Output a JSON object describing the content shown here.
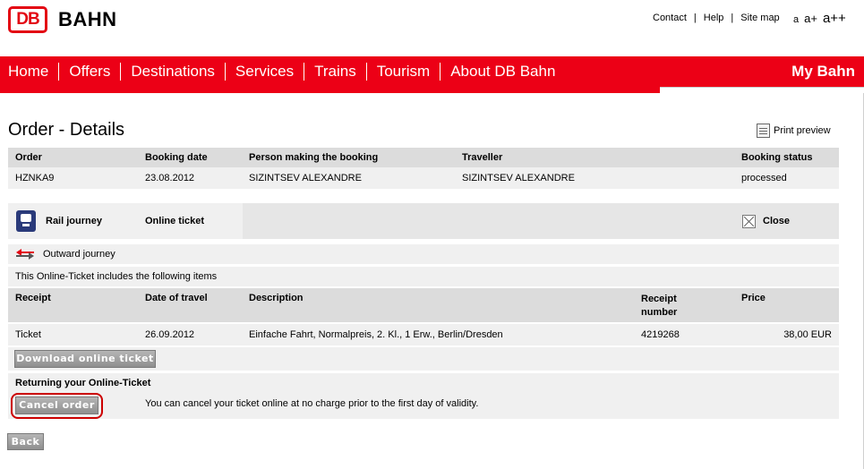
{
  "header": {
    "logo_db": "DB",
    "logo_text": "BAHN",
    "links": [
      "Contact",
      "Help",
      "Site map"
    ],
    "font_sizes": [
      "a",
      "a+",
      "a++"
    ]
  },
  "nav": {
    "items": [
      "Home",
      "Offers",
      "Destinations",
      "Services",
      "Trains",
      "Tourism",
      "About DB Bahn"
    ],
    "my_bahn": "My Bahn"
  },
  "page": {
    "title": "Order - Details",
    "print_preview": "Print preview"
  },
  "order_table": {
    "headers": [
      "Order",
      "Booking date",
      "Person making the booking",
      "Traveller",
      "Booking status"
    ],
    "row": [
      "HZNKA9",
      "23.08.2012",
      "SIZINTSEV ALEXANDRE",
      "SIZINTSEV ALEXANDRE",
      "processed"
    ]
  },
  "journey": {
    "type": "Rail journey",
    "ticket_type": "Online ticket",
    "close": "Close",
    "direction": "Outward journey",
    "includes_text": "This Online-Ticket includes the following items"
  },
  "items_table": {
    "headers": [
      "Receipt",
      "Date of travel",
      "Description",
      "Receipt number",
      "Price"
    ],
    "rows": [
      [
        "Ticket",
        "26.09.2012",
        "Einfache Fahrt, Normalpreis, 2. Kl., 1 Erw., Berlin/Dresden",
        "4219268",
        "38,00 EUR"
      ]
    ]
  },
  "actions": {
    "download": "Download online ticket",
    "returning_title": "Returning your Online-Ticket",
    "cancel": "Cancel order",
    "cancel_note": "You can cancel your ticket online at no charge prior to the first day of validity.",
    "back": "Back"
  },
  "colors": {
    "brand_red": "#ec0016",
    "header_grey": "#dcdcdc",
    "row_grey": "#f0f0f0"
  }
}
